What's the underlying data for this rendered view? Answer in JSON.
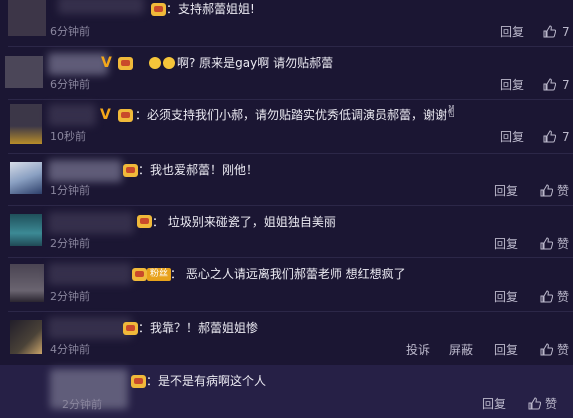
{
  "comments": [
    {
      "text": "：支持郝蕾姐姐!",
      "time": "6分钟前",
      "reply": "回复",
      "likes": "7"
    },
    {
      "text": "啊? 原来是gay啊 请勿贴郝蕾",
      "time": "6分钟前",
      "reply": "回复",
      "likes": "7"
    },
    {
      "text": "：必须支持我们小郝，请勿贴踏实优秀低调演员郝蕾，谢谢",
      "time": "10秒前",
      "reply": "回复",
      "likes": "7"
    },
    {
      "text": "：我也爱郝蕾！刚他！",
      "time": "1分钟前",
      "reply": "回复",
      "likes_label": "赞"
    },
    {
      "text": "： 垃圾别来碰瓷了，姐姐独自美丽",
      "time": "2分钟前",
      "reply": "回复",
      "likes_label": "赞"
    },
    {
      "text": "： 恶心之人请远离我们郝蕾老师  想红想疯了",
      "time": "2分钟前",
      "reply": "回复",
      "likes_label": "赞",
      "fan_badge": "粉丝"
    },
    {
      "text": "：我靠？！郝蕾姐姐惨",
      "time": "4分钟前",
      "report": "投诉",
      "block": "屏蔽",
      "reply": "回复",
      "likes_label": "赞"
    },
    {
      "text": "：是不是有病啊这个人",
      "time": "2分钟前",
      "reply": "回复",
      "likes_label": "赞"
    }
  ],
  "colors": {
    "background": "#1b1633",
    "highlight": "#262046",
    "badge": "#f0b93a",
    "vip": "#f3a71a"
  }
}
